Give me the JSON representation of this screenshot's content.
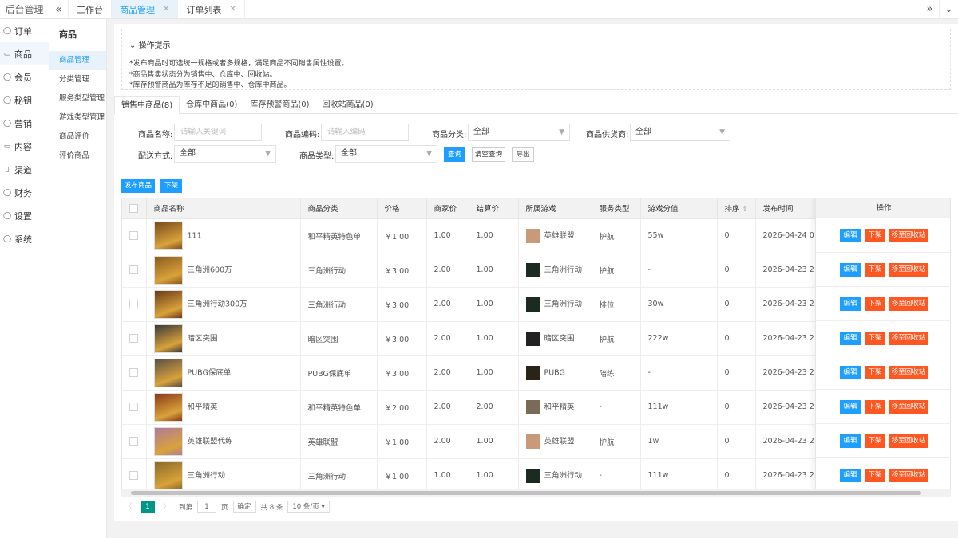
{
  "app": {
    "title": "后台管理"
  },
  "topbar": {
    "tabs": [
      {
        "label": "工作台"
      },
      {
        "label": "商品管理",
        "close": "✕"
      },
      {
        "label": "订单列表",
        "close": "✕"
      }
    ]
  },
  "nav1": [
    {
      "icon": "◯",
      "label": "订单"
    },
    {
      "icon": "▭",
      "label": "商品"
    },
    {
      "icon": "◯",
      "label": "会员"
    },
    {
      "icon": "◯",
      "label": "秘钥"
    },
    {
      "icon": "◯",
      "label": "营销"
    },
    {
      "icon": "▭",
      "label": "内容"
    },
    {
      "icon": "▯",
      "label": "渠道"
    },
    {
      "icon": "◯",
      "label": "财务"
    },
    {
      "icon": "◯",
      "label": "设置"
    },
    {
      "icon": "◯",
      "label": "系统"
    }
  ],
  "nav2": {
    "header": "商品",
    "items": [
      "商品管理",
      "分类管理",
      "服务类型管理",
      "游戏类型管理",
      "商品评价",
      "评价商品"
    ]
  },
  "tips": {
    "title": "操作提示",
    "lines": [
      "*发布商品时可选统一规格或者多规格，满足商品不同销售属性设置。",
      "*商品售卖状态分为销售中、仓库中、回收站。",
      "*库存预警商品为库存不足的销售中、仓库中商品。"
    ]
  },
  "status_tabs": [
    "销售中商品(8)",
    "仓库中商品(0)",
    "库存预警商品(0)",
    "回收站商品(0)"
  ],
  "filters": {
    "name_label": "商品名称:",
    "name_placeholder": "请输入关键词",
    "code_label": "商品编码:",
    "code_placeholder": "请输入编码",
    "category_label": "商品分类:",
    "category_value": "全部",
    "supplier_label": "商品供货商:",
    "supplier_value": "全部",
    "delivery_label": "配送方式:",
    "delivery_value": "全部",
    "type_label": "商品类型:",
    "type_value": "全部",
    "query": "查询",
    "clear": "清空查询",
    "export": "导出"
  },
  "actions": {
    "publish": "发布商品",
    "offline": "下架"
  },
  "table": {
    "headers": [
      "商品名称",
      "商品分类",
      "价格",
      "商家价",
      "结算价",
      "所属游戏",
      "服务类型",
      "游戏分值",
      "排序",
      "发布时间"
    ],
    "sort_icon": "⇕",
    "ops_header": "操作",
    "ops": {
      "edit": "编辑",
      "off": "下架",
      "recycle": "移至回收站"
    },
    "rows": [
      {
        "name": "111",
        "category": "和平精英特色单",
        "price": "￥1.00",
        "merchant": "1.00",
        "settle": "1.00",
        "game": "英雄联盟",
        "service": "护航",
        "score": "55w",
        "sort": "0",
        "time": "2026-04-24 0",
        "thumb_color": "#7a4a1c",
        "game_color": "#c89a7a"
      },
      {
        "name": "三角洲600万",
        "category": "三角洲行动",
        "price": "￥3.00",
        "merchant": "2.00",
        "settle": "1.00",
        "game": "三角洲行动",
        "service": "护航",
        "score": "-",
        "sort": "0",
        "time": "2026-04-23 2",
        "thumb_color": "#8a5a20",
        "game_color": "#1c2b22"
      },
      {
        "name": "三角洲行动300万",
        "category": "三角洲行动",
        "price": "￥3.00",
        "merchant": "2.00",
        "settle": "1.00",
        "game": "三角洲行动",
        "service": "排位",
        "score": "30w",
        "sort": "0",
        "time": "2026-04-23 2",
        "thumb_color": "#6a3a1a",
        "game_color": "#1c2b22"
      },
      {
        "name": "暗区突围",
        "category": "暗区突围",
        "price": "￥3.00",
        "merchant": "2.00",
        "settle": "1.00",
        "game": "暗区突围",
        "service": "护航",
        "score": "222w",
        "sort": "0",
        "time": "2026-04-23 2",
        "thumb_color": "#3a3a3a",
        "game_color": "#222222"
      },
      {
        "name": "PUBG保底单",
        "category": "PUBG保底单",
        "price": "￥3.00",
        "merchant": "2.00",
        "settle": "1.00",
        "game": "PUBG",
        "service": "陪练",
        "score": "-",
        "sort": "0",
        "time": "2026-04-23 2",
        "thumb_color": "#5a5048",
        "game_color": "#2a2418"
      },
      {
        "name": "和平精英",
        "category": "和平精英特色单",
        "price": "￥2.00",
        "merchant": "2.00",
        "settle": "2.00",
        "game": "和平精英",
        "service": "-",
        "score": "111w",
        "sort": "0",
        "time": "2026-04-23 2",
        "thumb_color": "#8a3a18",
        "game_color": "#7a6a58"
      },
      {
        "name": "英雄联盟代练",
        "category": "英雄联盟",
        "price": "￥1.00",
        "merchant": "2.00",
        "settle": "1.00",
        "game": "英雄联盟",
        "service": "护航",
        "score": "1w",
        "sort": "0",
        "time": "2026-04-23 2",
        "thumb_color": "#b07a9a",
        "game_color": "#c89a7a"
      },
      {
        "name": "三角洲行动",
        "category": "三角洲行动",
        "price": "￥1.00",
        "merchant": "1.00",
        "settle": "1.00",
        "game": "三角洲行动",
        "service": "-",
        "score": "111w",
        "sort": "0",
        "time": "2026-04-23 2",
        "thumb_color": "#8a6a2a",
        "game_color": "#1c2b22"
      }
    ]
  },
  "pager": {
    "prev": "〈",
    "current": "1",
    "next": "〉",
    "goto": "到第",
    "page_input": "1",
    "page_unit": "页",
    "confirm": "确定",
    "total": "共 8 条",
    "size": "10 条/页"
  }
}
